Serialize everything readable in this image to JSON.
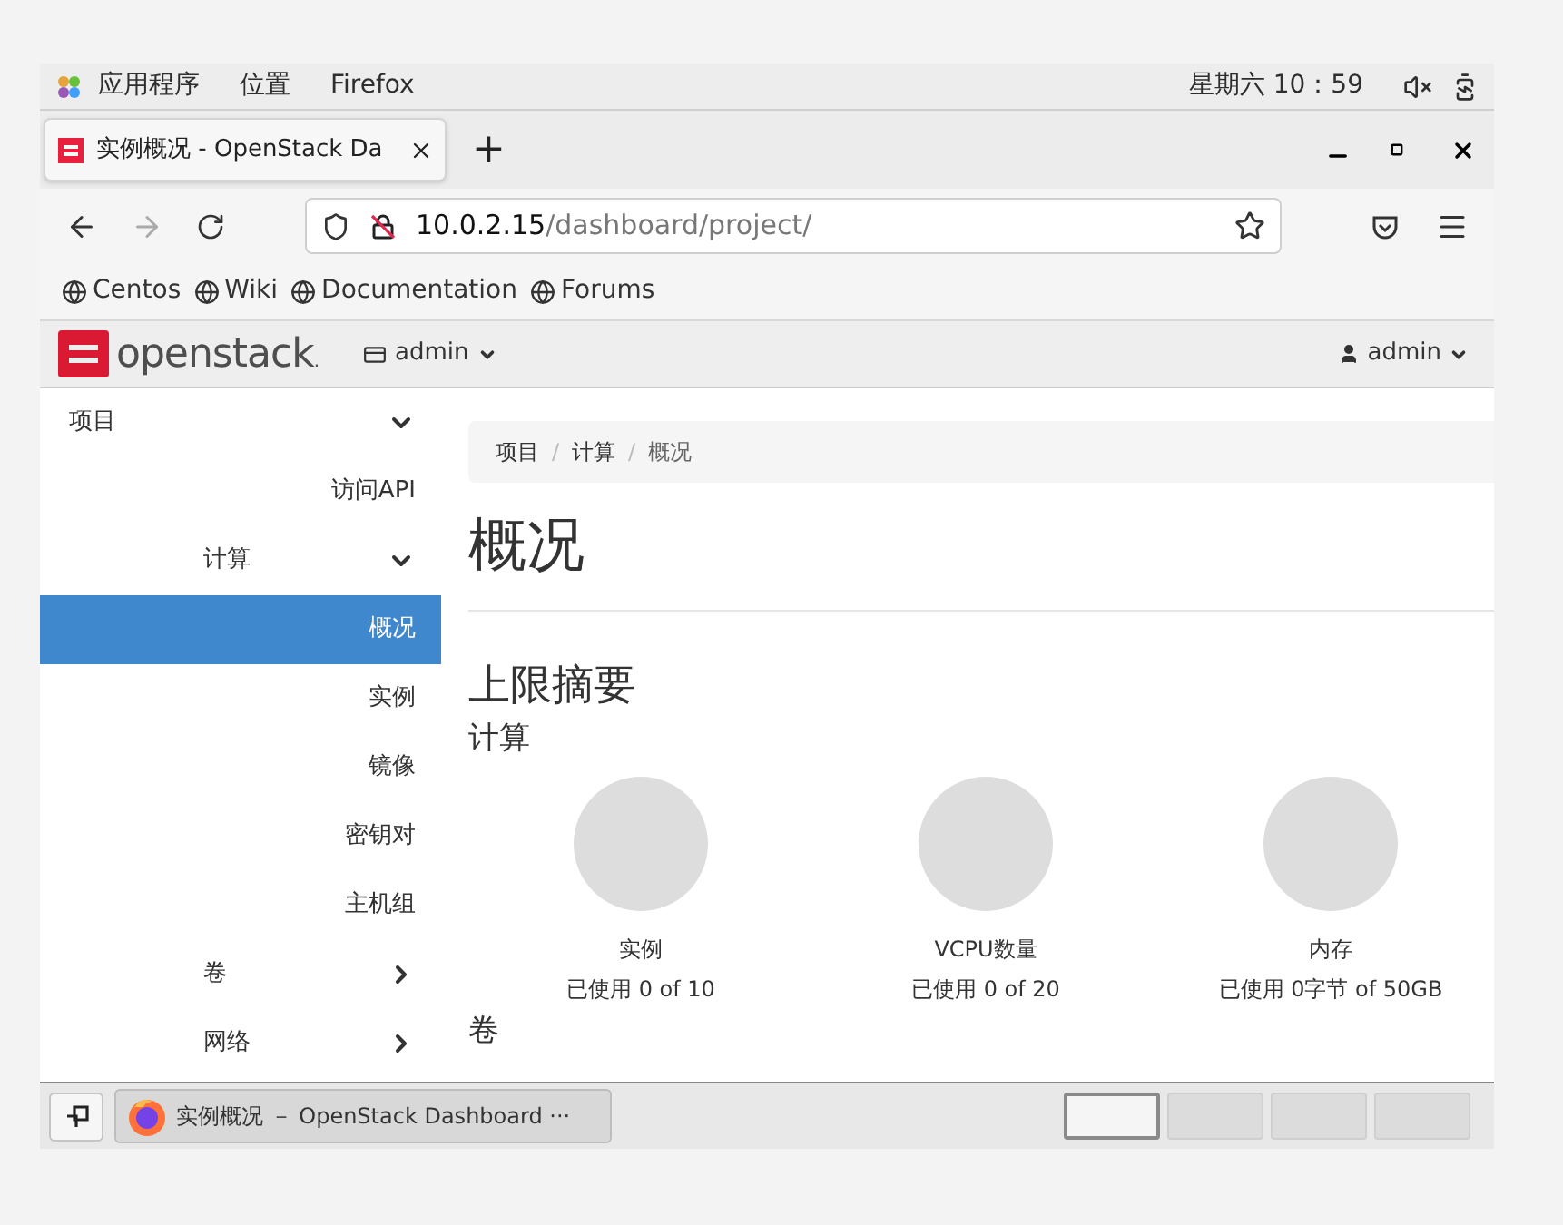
{
  "top_bar": {
    "menus": [
      "应用程序",
      "位置",
      "Firefox"
    ],
    "clock": "星期六 10：59"
  },
  "browser": {
    "tab": {
      "title": "实例概况 - OpenStack Da",
      "selected": true
    },
    "new_tab": "+",
    "url": {
      "host": "10.0.2.15",
      "path": "/dashboard/project/"
    },
    "bookmarks": [
      "Centos",
      "Wiki",
      "Documentation",
      "Forums"
    ]
  },
  "header": {
    "logo": "openstack",
    "logo_mark": ".",
    "project": "admin",
    "user": "admin"
  },
  "sidebar": [
    {
      "label": "项目",
      "expanded": true,
      "children": [
        {
          "label": "访问API",
          "selected": false
        },
        {
          "label": "计算",
          "expanded": true,
          "children": [
            {
              "label": "概况",
              "selected": true
            },
            {
              "label": "实例",
              "selected": false
            },
            {
              "label": "镜像",
              "selected": false
            },
            {
              "label": "密钥对",
              "selected": false
            },
            {
              "label": "主机组",
              "selected": false
            }
          ]
        },
        {
          "label": "卷",
          "expanded": false
        },
        {
          "label": "网络",
          "expanded": false
        }
      ]
    }
  ],
  "breadcrumb": [
    {
      "kind": "link",
      "text": "项目"
    },
    {
      "kind": "separator",
      "text": "/"
    },
    {
      "kind": "link",
      "text": "计算"
    },
    {
      "kind": "separator",
      "text": "/"
    },
    {
      "kind": "current",
      "text": "概况"
    }
  ],
  "page_title": "概况",
  "limits": {
    "title": "上限摘要",
    "section": "计算",
    "gauges": [
      {
        "label": "实例",
        "usage": "已使用 0 of 10"
      },
      {
        "label": "VCPU数量",
        "usage": "已使用 0 of 20"
      },
      {
        "label": "内存",
        "usage": "已使用 0字节 of 50GB"
      }
    ],
    "next_section": "卷"
  },
  "taskbar": {
    "window": "实例概况 － OpenStack Dashboard ···",
    "workspaces": [
      {
        "selected": true
      },
      {
        "selected": false
      },
      {
        "selected": false
      },
      {
        "selected": false
      }
    ]
  }
}
